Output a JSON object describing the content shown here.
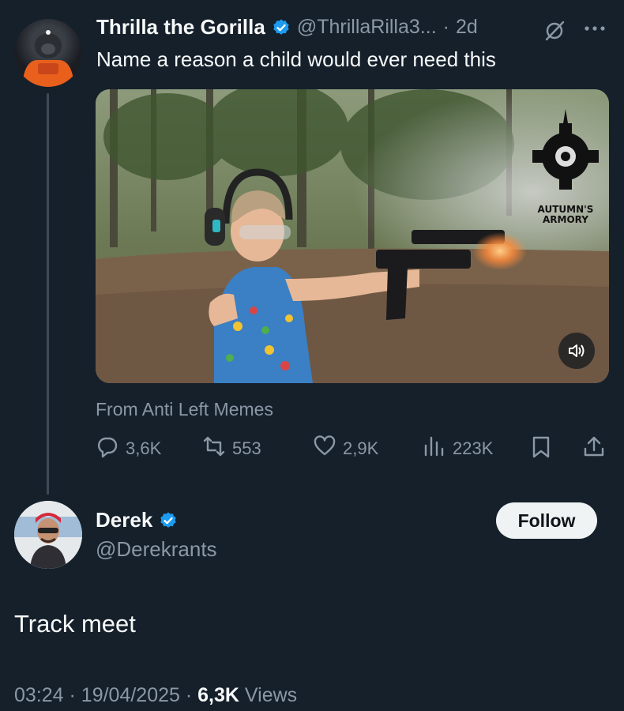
{
  "tweet": {
    "author_name": "Thrilla the Gorilla",
    "handle": "@ThrillaRilla3...",
    "separator": "·",
    "age": "2d",
    "text": "Name a reason a child would ever need this",
    "media_logo_text_1": "AUTUMN'S",
    "media_logo_text_2": "ARMORY",
    "source": "From Anti Left Memes",
    "stats": {
      "replies": "3,6K",
      "retweets": "553",
      "likes": "2,9K",
      "views": "223K"
    }
  },
  "reply": {
    "author_name": "Derek",
    "handle": "@Derekrants",
    "follow_label": "Follow",
    "text": "Track meet",
    "time": "03:24",
    "sep": "·",
    "date": "19/04/2025",
    "views_count": "6,3K",
    "views_label": "Views"
  },
  "colors": {
    "background": "#15202b",
    "verified": "#1d9bf0",
    "muted": "#8b98a5",
    "text": "#f7f9f9"
  },
  "icons": [
    "verified-badge-icon",
    "grok-icon",
    "more-icon",
    "reply-icon",
    "retweet-icon",
    "like-icon",
    "views-icon",
    "bookmark-icon",
    "share-icon",
    "volume-icon"
  ]
}
